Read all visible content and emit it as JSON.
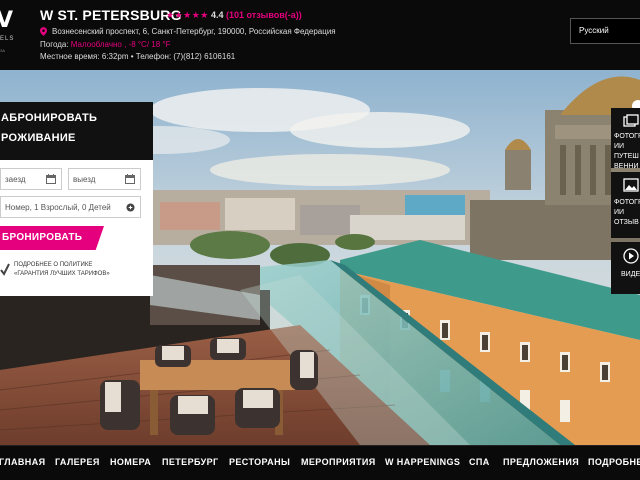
{
  "header": {
    "logo_letter": "V",
    "logo_line1": "ELS",
    "logo_line2": "ЗА",
    "hotel_name": "W ST. PETERSBURG",
    "stars": "★★★★★",
    "rating": "4.4",
    "reviews": "(101 отзывов(-а))",
    "address": "Вознесенский проспект, 6, Санкт-Петербург, 190000, Российская Федерация",
    "weather_label": "Погода:",
    "weather_value": "Малооблачно , -8 °C/ 18 °F",
    "time_line": "Местное время: 6:32pm  •  Телефон: (7)(812) 6106161",
    "language": "Русский"
  },
  "booking": {
    "title_line1": "АБРОНИРОВАТЬ",
    "title_line2": "РОЖИВАНИЕ",
    "checkin_placeholder": "заезд",
    "checkout_placeholder": "выезд",
    "guests": "Номер, 1 Взрослый, 0 Детей",
    "book_button": "БРОНИРОВАТЬ",
    "policy_line1": "ПОДРОБНЕЕ О ПОЛИТИКЕ",
    "policy_line2": "«ГАРАНТИЯ ЛУЧШИХ ТАРИФОВ»"
  },
  "media": {
    "photos_label": "ФОТОГРА\nИИ\nПУТЕШ\nВЕННИ",
    "photos2_label": "ФОТОГР\nИИ\nОТЗЫВ",
    "video_label": "ВИДЕ"
  },
  "nav": {
    "items": [
      "ГЛАВНАЯ",
      "ГАЛЕРЕЯ",
      "НОМЕРА",
      "ПЕТЕРБУРГ",
      "РЕСТОРАНЫ",
      "МЕРОПРИЯТИЯ",
      "W HAPPENINGS",
      "СПА",
      "ПРЕДЛОЖЕНИЯ",
      "ПОДРОБНЕЕ"
    ]
  },
  "colors": {
    "accent": "#e5007e",
    "header_bg": "#0a0a0a"
  }
}
